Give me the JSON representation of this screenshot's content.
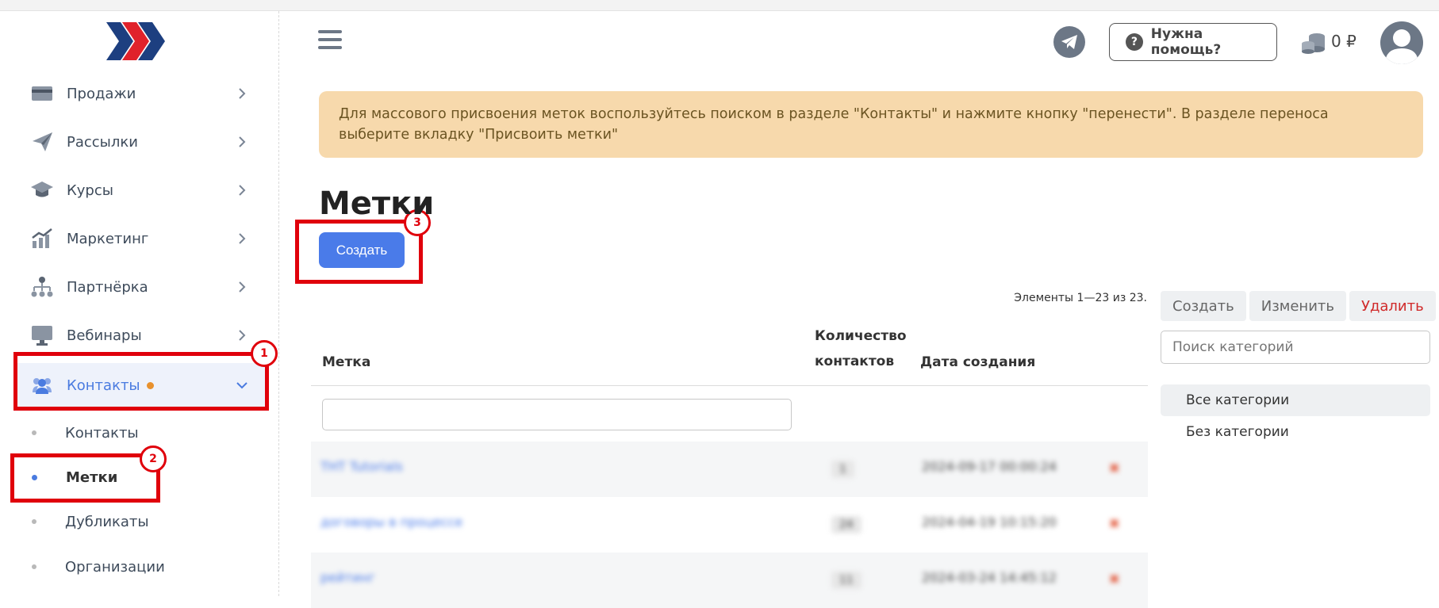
{
  "sidebar": {
    "menu": [
      {
        "label": "Продажи",
        "icon": "card-icon"
      },
      {
        "label": "Рассылки",
        "icon": "paper-plane-icon"
      },
      {
        "label": "Курсы",
        "icon": "graduation-cap-icon"
      },
      {
        "label": "Маркетинг",
        "icon": "bar-chart-icon"
      },
      {
        "label": "Партнёрка",
        "icon": "org-chart-icon"
      },
      {
        "label": "Вебинары",
        "icon": "monitor-icon"
      },
      {
        "label": "Контакты",
        "icon": "users-icon"
      }
    ],
    "submenu": [
      {
        "label": "Контакты"
      },
      {
        "label": "Метки"
      },
      {
        "label": "Дубликаты"
      },
      {
        "label": "Организации"
      }
    ],
    "annotations": [
      "1",
      "2",
      "3"
    ]
  },
  "header": {
    "help_label": "Нужна помощь?",
    "help_icon": "?",
    "balance": "0 ₽"
  },
  "alert": {
    "text": "Для массового присвоения меток воспользуйтесь поиском в разделе \"Контакты\" и нажмите кнопку \"перенести\". В разделе переноса выберите вкладку \"Присвоить метки\""
  },
  "main": {
    "title": "Метки",
    "create_label": "Создать",
    "count_text": "Элементы 1—23 из 23.",
    "columns": {
      "tag": "Метка",
      "contacts_line1": "Количество",
      "contacts_line2": "контактов",
      "created": "Дата создания"
    },
    "rows": [
      {
        "name": "ТНТ Tutorials",
        "count": "1",
        "date": "2024-09-17 00:00:24",
        "action": "✖"
      },
      {
        "name": "договоры в процессе",
        "count": "24",
        "date": "2024-04-19 10:15:20",
        "action": "✖"
      },
      {
        "name": "рейтинг",
        "count": "11",
        "date": "2024-03-24 14:45:12",
        "action": "✖"
      }
    ]
  },
  "categories": {
    "actions": {
      "create": "Создать",
      "edit": "Изменить",
      "delete": "Удалить"
    },
    "search_placeholder": "Поиск категорий",
    "items": [
      "Все категории",
      "Без категории"
    ]
  }
}
